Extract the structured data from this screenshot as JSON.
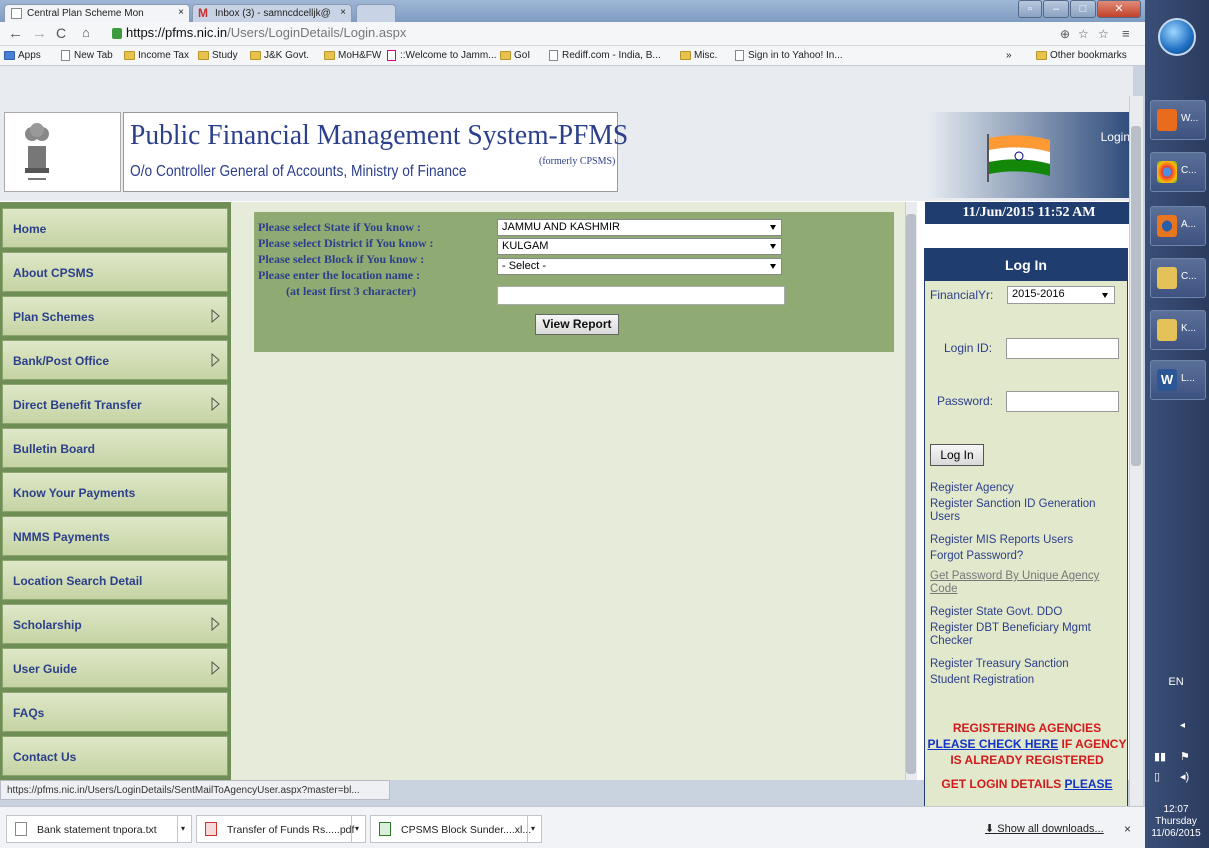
{
  "browser": {
    "tabs": [
      {
        "label": "Central Plan Scheme Mon",
        "active": true
      },
      {
        "label": "Inbox (3) - samncdcelljk@",
        "active": false
      }
    ],
    "url_host": "https://pfms.nic.in",
    "url_path": "/Users/LoginDetails/Login.aspx",
    "bookmarks": [
      "Apps",
      "New Tab",
      "Income Tax",
      "Study",
      "J&K Govt.",
      "MoH&FW",
      "::Welcome to Jamm...",
      "GoI",
      "Rediff.com - India, B...",
      "Misc.",
      "Sign in to Yahoo! In..."
    ],
    "bookmarks_overflow": "»",
    "other_bookmarks": "Other bookmarks",
    "status_url": "https://pfms.nic.in/Users/LoginDetails/SentMailToAgencyUser.aspx?master=bl..."
  },
  "header": {
    "title": "Public Financial Management System-PFMS",
    "formerly": "(formerly CPSMS)",
    "subtitle": "O/o Controller General of Accounts, Ministry of Finance",
    "login_link": "Login",
    "datetime": "11/Jun/2015 11:52 AM"
  },
  "sidebar": {
    "items": [
      {
        "label": "Home",
        "submenu": false
      },
      {
        "label": "About CPSMS",
        "submenu": false
      },
      {
        "label": "Plan Schemes",
        "submenu": true
      },
      {
        "label": "Bank/Post Office",
        "submenu": true
      },
      {
        "label": "Direct Benefit Transfer",
        "submenu": true
      },
      {
        "label": "Bulletin Board",
        "submenu": false
      },
      {
        "label": "Know Your Payments",
        "submenu": false
      },
      {
        "label": "NMMS Payments",
        "submenu": false
      },
      {
        "label": "Location Search Detail",
        "submenu": false
      },
      {
        "label": "Scholarship",
        "submenu": true
      },
      {
        "label": "User Guide",
        "submenu": true
      },
      {
        "label": "FAQs",
        "submenu": false
      },
      {
        "label": "Contact Us",
        "submenu": false
      }
    ]
  },
  "form": {
    "state_label": "Please select State if You know :",
    "state_value": "JAMMU AND KASHMIR",
    "district_label": "Please select District if You know :",
    "district_value": "KULGAM",
    "block_label": "Please select Block if You know :",
    "block_value": "- Select -",
    "location_label": "Please enter the location name   :",
    "location_hint": "(at least first 3 character)",
    "location_value": "",
    "view_report": "View Report"
  },
  "login": {
    "heading": "Log In",
    "fy_label": "FinancialYr:",
    "fy_value": "2015-2016",
    "id_label": "Login ID:",
    "password_label": "Password:",
    "button": "Log In",
    "links": [
      "Register Agency",
      "Register Sanction ID Generation Users",
      "Register MIS Reports Users",
      "Forgot Password?",
      "Get Password By Unique Agency Code",
      "Register State Govt. DDO",
      "Register DBT Beneficiary Mgmt Checker",
      "Register Treasury Sanction",
      "Student Registration"
    ],
    "reg_line1": "REGISTERING AGENCIES",
    "reg_check": "PLEASE CHECK HERE",
    "reg_line2a": " IF AGENCY",
    "reg_line3": "IS ALREADY REGISTERED",
    "get_login": "GET LOGIN DETAILS ",
    "get_login_link": "PLEASE"
  },
  "downloads": {
    "items": [
      "Bank statement tnpora.txt",
      "Transfer of Funds Rs.....pdf",
      "CPSMS Block Sunder....xl..."
    ],
    "show_all": "Show all downloads...",
    "close": "×"
  },
  "taskbar": {
    "items": [
      "W...",
      "C...",
      "A...",
      "C...",
      "K...",
      "L..."
    ],
    "language": "EN",
    "time": "12:07",
    "day": "Thursday",
    "date": "11/06/2015"
  },
  "colors": {
    "nav_blue": "#1f3d6f",
    "title_blue": "#2c3f8b",
    "menu_green": "#c5d3a3",
    "form_green": "#8faa72",
    "alert_red": "#d21a1a"
  }
}
